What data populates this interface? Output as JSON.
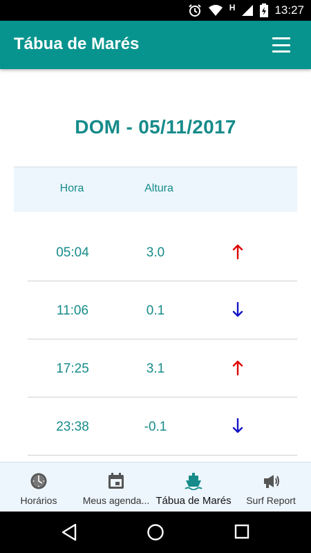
{
  "status_bar": {
    "time": "13:27",
    "network_label": "H"
  },
  "app_bar": {
    "title": "Tábua de Marés"
  },
  "date_title": "DOM - 05/11/2017",
  "table": {
    "headers": [
      "Hora",
      "Altura"
    ],
    "rows": [
      {
        "time": "05:04",
        "height": "3.0",
        "direction": "up"
      },
      {
        "time": "11:06",
        "height": "0.1",
        "direction": "down"
      },
      {
        "time": "17:25",
        "height": "3.1",
        "direction": "up"
      },
      {
        "time": "23:38",
        "height": "-0.1",
        "direction": "down"
      }
    ]
  },
  "bottom_nav": {
    "items": [
      {
        "label": "Horários",
        "icon": "clock-icon"
      },
      {
        "label": "Meus agenda...",
        "icon": "calendar-icon"
      },
      {
        "label": "Tábua de Marés",
        "icon": "ship-icon",
        "active": true
      },
      {
        "label": "Surf Report",
        "icon": "megaphone-icon"
      }
    ]
  },
  "colors": {
    "primary": "#08948e",
    "text_teal": "#168b8a",
    "arrow_up": "#e00000",
    "arrow_down": "#1414c8",
    "header_bg": "#edf6fd"
  }
}
